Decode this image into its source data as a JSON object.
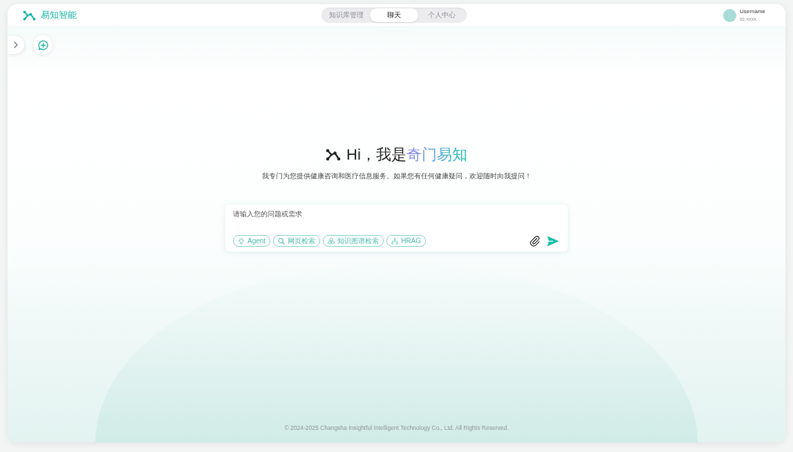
{
  "header": {
    "logo_text": "易知智能",
    "tabs": [
      {
        "label": "知识库管理",
        "selected": false
      },
      {
        "label": "聊天",
        "selected": true
      },
      {
        "label": "个人中心",
        "selected": false
      }
    ],
    "user": {
      "name": "Username",
      "id": "Id: xxxx"
    }
  },
  "greeting": {
    "text": "Hi，我是",
    "highlight": "奇门易知"
  },
  "description": "我专门为您提供健康咨询和医疗信息服务。如果您有任何健康疑问，欢迎随时向我提问！",
  "composer": {
    "placeholder": "请输入您的问题或需求",
    "tools": [
      {
        "kind": "agent",
        "label": "Agent",
        "selected": false
      },
      {
        "kind": "web",
        "label": "网页检索",
        "selected": false
      },
      {
        "kind": "graph",
        "label": "知识图谱检索",
        "selected": false
      },
      {
        "kind": "hrag",
        "label": "HRAG",
        "selected": false
      }
    ]
  },
  "footer": "© 2024-2025 Changsha Insightful Intelligent Technology Co., Ltd. All Rights Reserved."
}
